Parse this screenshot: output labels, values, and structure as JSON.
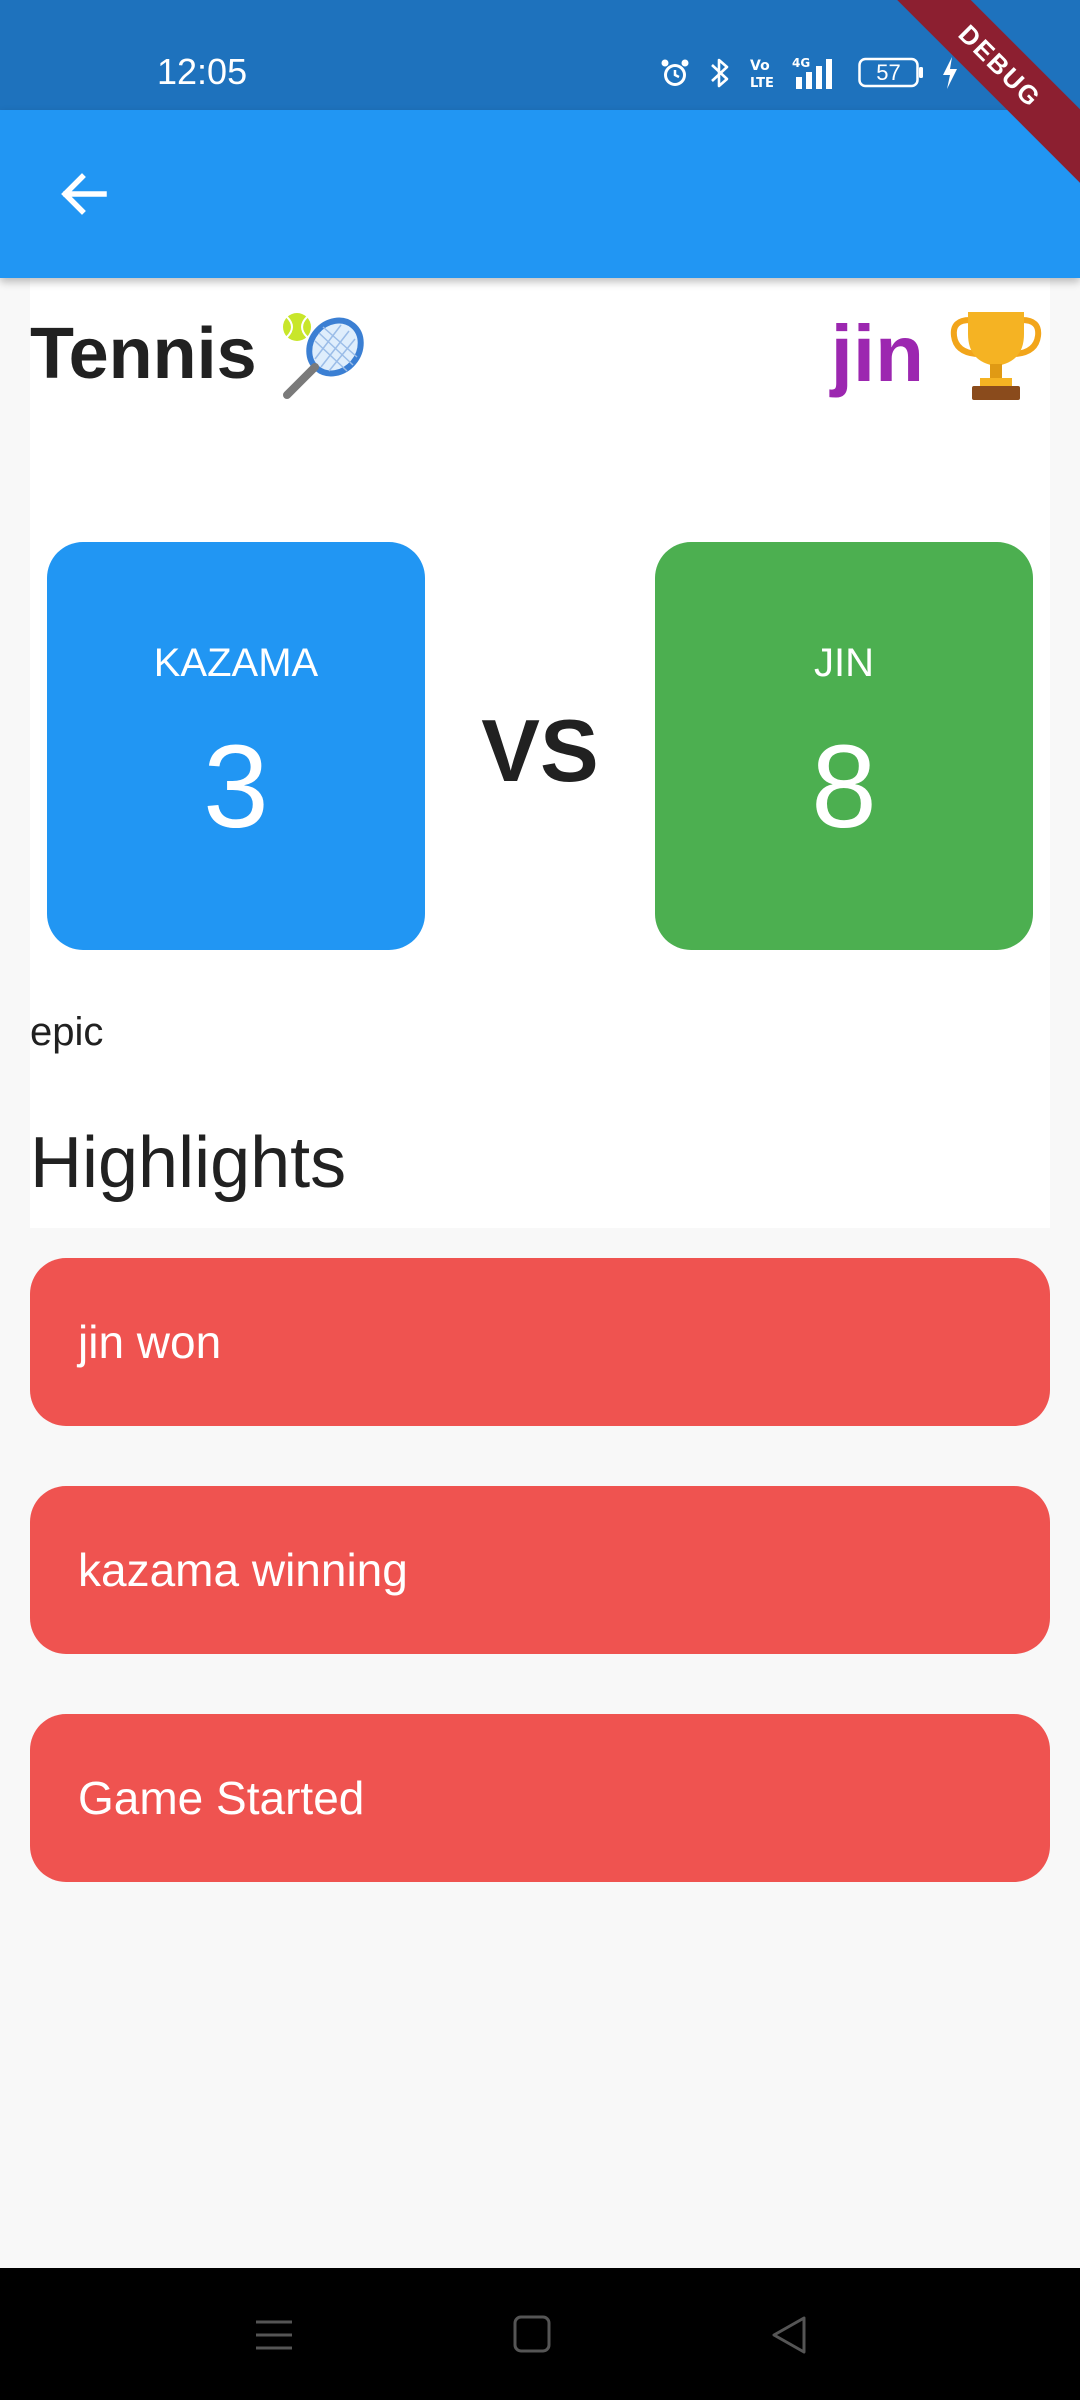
{
  "status_bar": {
    "time": "12:05",
    "battery": "57",
    "icons": [
      "alarm-icon",
      "bluetooth-icon",
      "volte-icon",
      "4g-signal-icon",
      "battery-icon",
      "charging-icon"
    ]
  },
  "debug_banner": "DEBUG",
  "app_bar": {
    "back_icon": "arrow-back-icon"
  },
  "match": {
    "sport": "Tennis",
    "sport_emoji": "tennis-racket-icon",
    "winner": "jin",
    "winner_emoji": "trophy-icon",
    "team_a": {
      "name": "KAZAMA",
      "score": "3",
      "color": "#2196f3"
    },
    "vs_label": "VS",
    "team_b": {
      "name": "JIN",
      "score": "8",
      "color": "#4caf50"
    },
    "description": "epic"
  },
  "highlights": {
    "heading": "Highlights",
    "items": [
      {
        "text": "jin won"
      },
      {
        "text": "kazama winning"
      },
      {
        "text": "Game Started"
      }
    ],
    "card_color": "#ef5350"
  },
  "nav_bar": {
    "icons": [
      "menu-icon",
      "home-icon",
      "back-icon"
    ]
  },
  "colors": {
    "app_bar": "#2196f3",
    "status_bar": "#1e72bd",
    "winner": "#9c27b0"
  }
}
